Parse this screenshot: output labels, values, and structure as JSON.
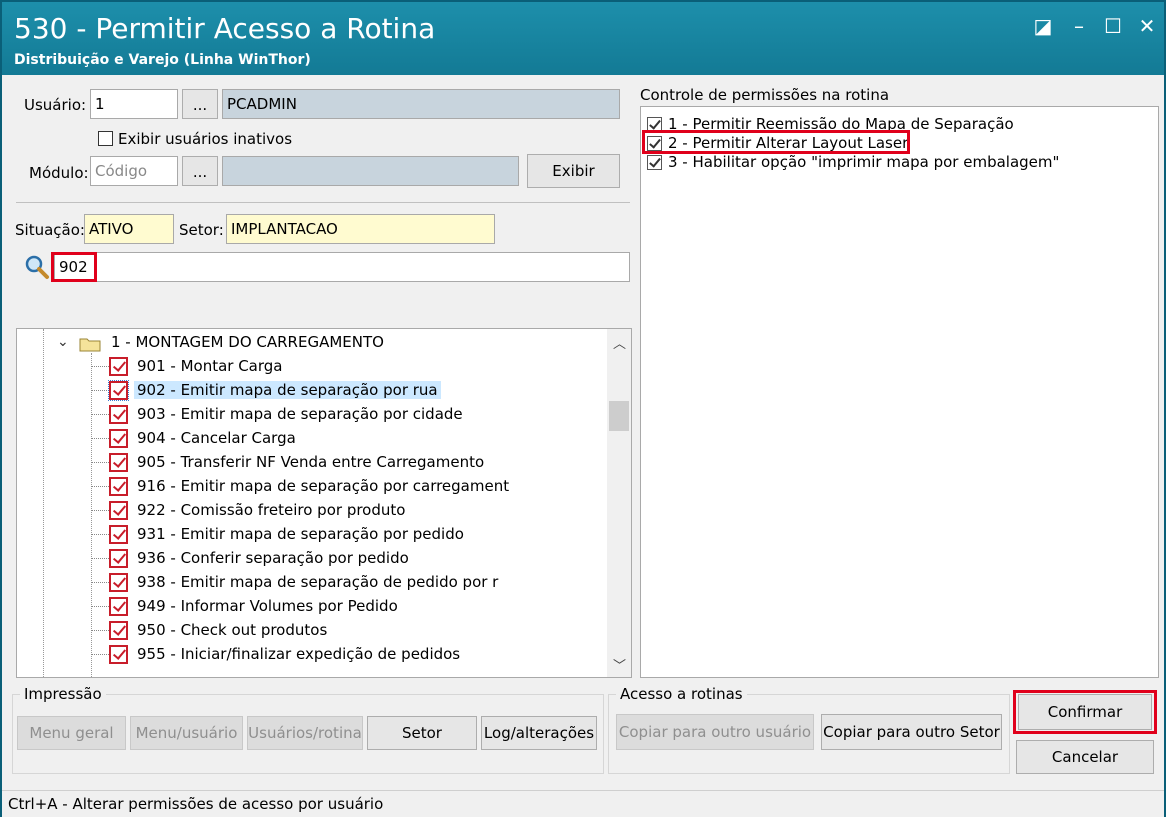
{
  "window": {
    "title": "530 - Permitir Acesso a Rotina",
    "subtitle": "Distribuição e Varejo (Linha WinThor)",
    "controls": {
      "restore": "◪",
      "minimize": "–",
      "maximize": "☐",
      "close": "✕"
    }
  },
  "form": {
    "usuario_label": "Usuário:",
    "usuario_code": "1",
    "browse_label": "...",
    "usuario_name": "PCADMIN",
    "inativos_label": "Exibir usuários inativos",
    "modulo_label": "Módulo:",
    "modulo_placeholder": "Código",
    "exibir_label": "Exibir",
    "situacao_label": "Situação:",
    "situacao_value": "ATIVO",
    "setor_label": "Setor:",
    "setor_value": "IMPLANTACAO",
    "search_value": "902"
  },
  "tree": {
    "folder_label": "1 - MONTAGEM DO CARREGAMENTO",
    "items": [
      "901 - Montar Carga",
      "902 - Emitir mapa de separação por rua",
      "903 - Emitir mapa de separação por cidade",
      "904 - Cancelar Carga",
      "905 - Transferir NF Venda entre Carregamento",
      "916 - Emitir mapa de separação por carregament",
      "922 - Comissão freteiro por produto",
      "931 - Emitir mapa de separação por pedido",
      "936 - Conferir separação por pedido",
      "938 - Emitir mapa de separação de pedido por r",
      "949 - Informar Volumes por Pedido",
      "950 - Check out produtos",
      "955 - Iniciar/finalizar expedição de pedidos"
    ],
    "selected_index": 1
  },
  "permissions": {
    "title": "Controle de permissões na rotina",
    "items": [
      "1 - Permitir Reemissão do Mapa de Separação",
      "2 - Permitir Alterar Layout Laser",
      "3 - Habilitar opção \"imprimir mapa por embalagem\""
    ]
  },
  "impressao": {
    "title": "Impressão",
    "buttons": [
      "Menu geral",
      "Menu/usuário",
      "Usuários/rotina",
      "Setor",
      "Log/alterações"
    ]
  },
  "acesso": {
    "title": "Acesso a rotinas",
    "buttons": [
      "Copiar para outro usuário",
      "Copiar para outro Setor"
    ]
  },
  "actions": {
    "confirm": "Confirmar",
    "cancel": "Cancelar"
  },
  "status": "Ctrl+A - Alterar permissões de acesso por usuário"
}
